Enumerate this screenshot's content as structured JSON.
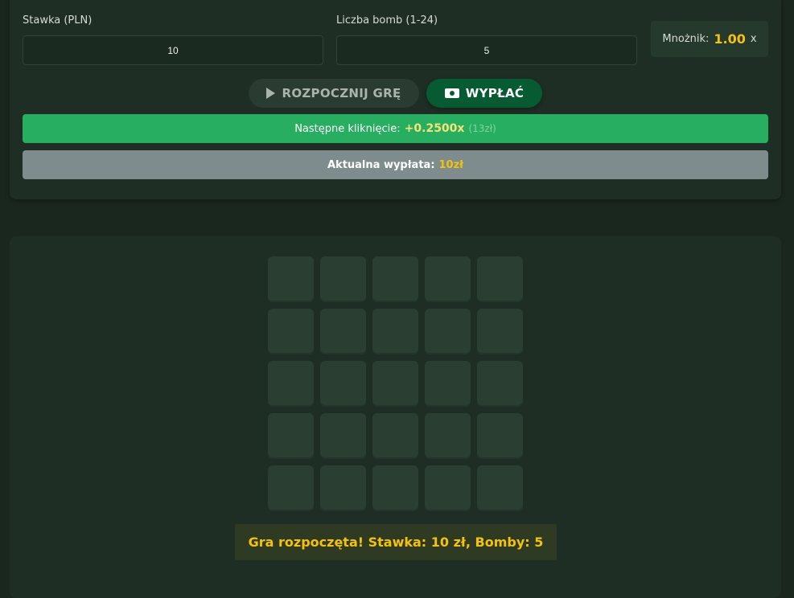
{
  "stake": {
    "label": "Stawka (PLN)",
    "value": "10"
  },
  "bombs": {
    "label": "Liczba bomb (1-24)",
    "value": "5"
  },
  "multiplier": {
    "label": "Mnożnik:",
    "value": "1.00",
    "suffix": "x"
  },
  "buttons": {
    "start_icon": "play-icon",
    "start_label": "ROZPOCZNIJ GRĘ",
    "cashout_icon": "money-icon",
    "cashout_label": "WYPŁAĆ"
  },
  "next_click": {
    "label": "Następne kliknięcie:",
    "value": "+0.2500x",
    "amount": "(13zł)"
  },
  "current_payout": {
    "label": "Aktualna wypłata:",
    "value": "10zł"
  },
  "grid": {
    "rows": 5,
    "cols": 5
  },
  "status_message": "Gra rozpoczęta! Stawka: 10 zł, Bomby: 5",
  "colors": {
    "background": "#1a271f",
    "panel": "#1e2e24",
    "tile": "#2a3e31",
    "accent_green": "#27ae60",
    "cashout_green": "#075b33",
    "gold": "#f4c20d",
    "payout_bar": "#7f8c8d"
  }
}
